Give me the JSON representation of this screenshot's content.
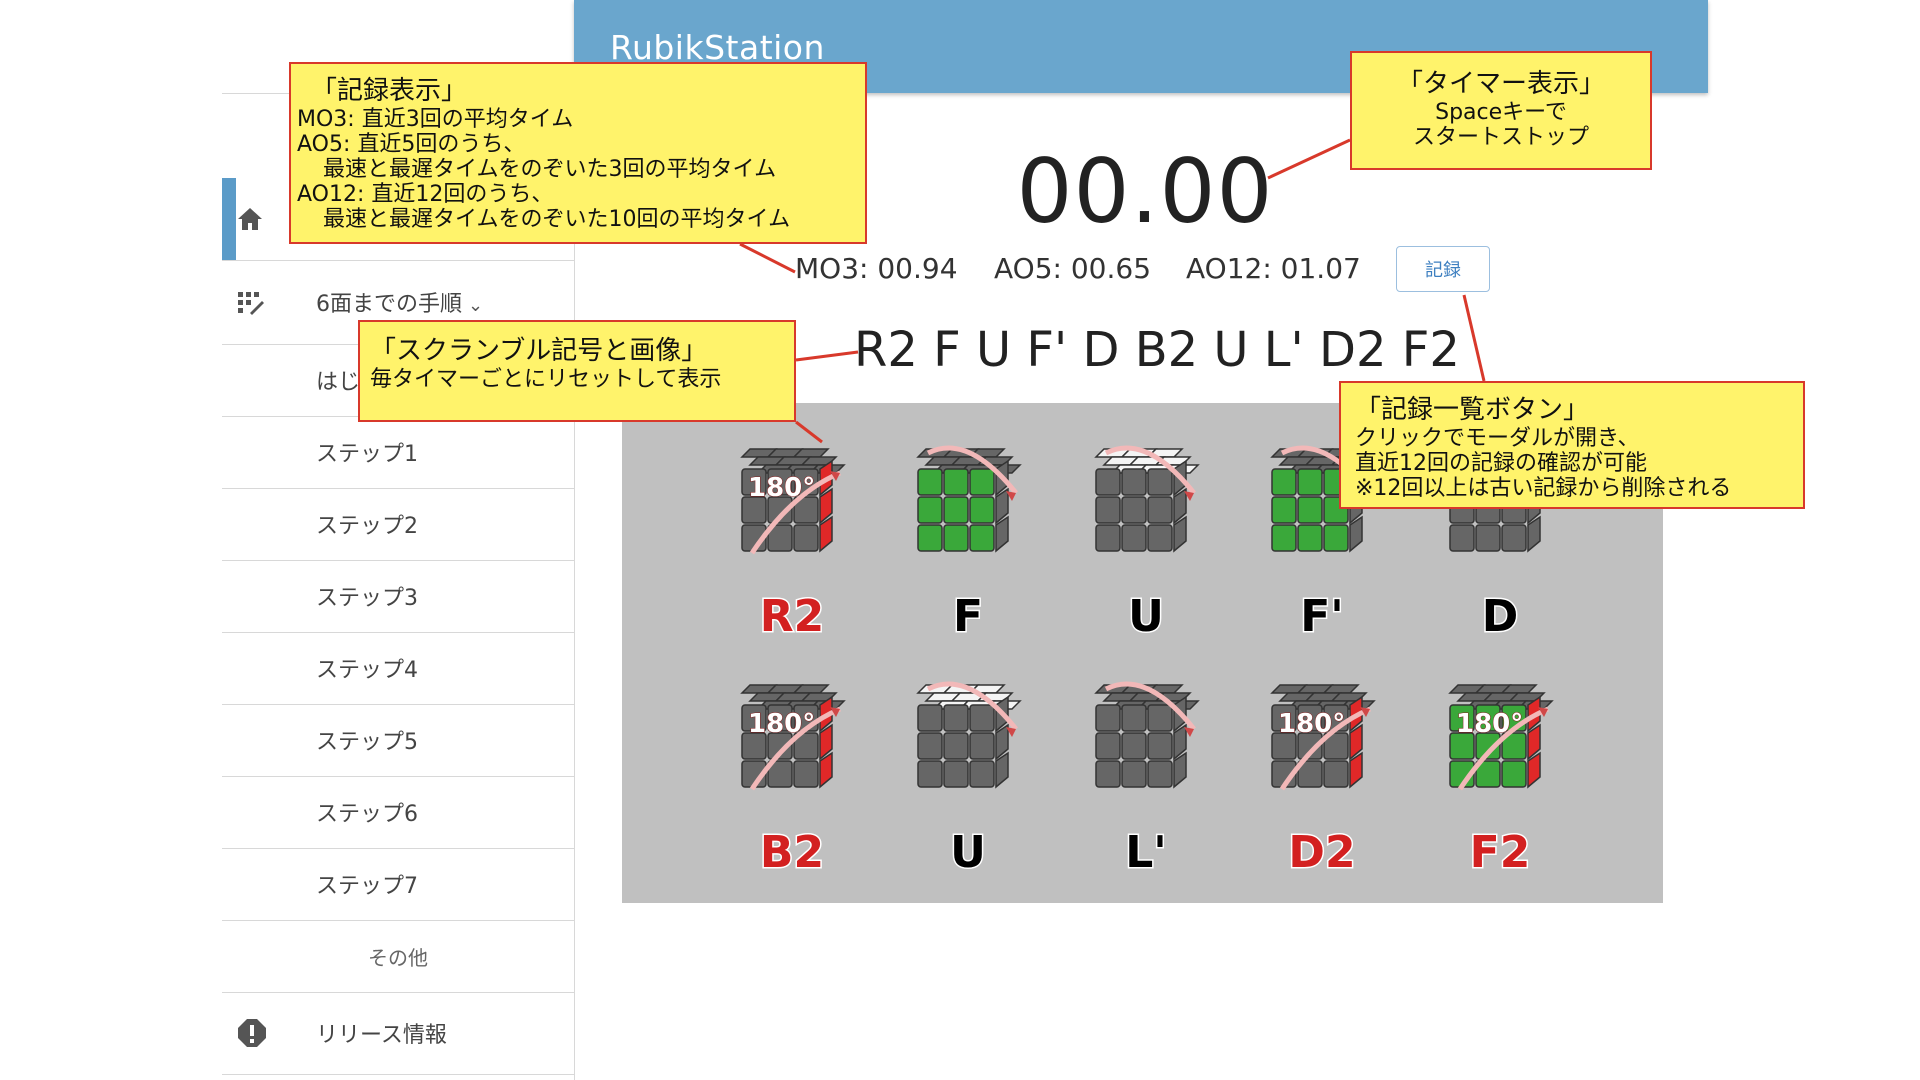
{
  "header": {
    "app_title": "RubikStation"
  },
  "sidebar": {
    "home_icon": "home-icon",
    "items": [
      {
        "id": "steps",
        "label": "6面までの手順",
        "icon": "steps-icon"
      },
      {
        "id": "start",
        "label": "はじ"
      },
      {
        "id": "step1",
        "label": "ステップ1"
      },
      {
        "id": "step2",
        "label": "ステップ2"
      },
      {
        "id": "step3",
        "label": "ステップ3"
      },
      {
        "id": "step4",
        "label": "ステップ4"
      },
      {
        "id": "step5",
        "label": "ステップ5"
      },
      {
        "id": "step6",
        "label": "ステップ6"
      },
      {
        "id": "step7",
        "label": "ステップ7"
      },
      {
        "id": "other",
        "label": "その他"
      },
      {
        "id": "release",
        "label": "リリース情報",
        "icon": "alert-icon"
      }
    ]
  },
  "timer": {
    "value": "00.00"
  },
  "stats": {
    "mo3": "MO3: 00.94",
    "ao5": "AO5: 00.65",
    "ao12": "AO12: 01.07"
  },
  "record_button": {
    "label": "記録"
  },
  "scramble": {
    "text": "R2 F U F' D B2 U L' D2 F2",
    "moves": [
      {
        "label": "R2",
        "double": true,
        "rotation": "180°"
      },
      {
        "label": "F",
        "double": false,
        "rotation": ""
      },
      {
        "label": "U",
        "double": false,
        "rotation": ""
      },
      {
        "label": "F'",
        "double": false,
        "rotation": ""
      },
      {
        "label": "D",
        "double": false,
        "rotation": ""
      },
      {
        "label": "B2",
        "double": true,
        "rotation": "180°"
      },
      {
        "label": "U",
        "double": false,
        "rotation": ""
      },
      {
        "label": "L'",
        "double": false,
        "rotation": ""
      },
      {
        "label": "D2",
        "double": true,
        "rotation": "180°"
      },
      {
        "label": "F2",
        "double": true,
        "rotation": "180°"
      }
    ]
  },
  "callouts": {
    "records": {
      "title": "「記録表示」",
      "lines": [
        "MO3: 直近3回の平均タイム",
        "AO5: 直近5回のうち、",
        "最速と最遅タイムをのぞいた3回の平均タイム",
        "AO12: 直近12回のうち、",
        "最速と最遅タイムをのぞいた10回の平均タイム"
      ]
    },
    "timer": {
      "title": "「タイマー表示」",
      "lines": [
        "Spaceキーで",
        "スタートストップ"
      ]
    },
    "scramble": {
      "title": "「スクランブル記号と画像」",
      "lines": [
        "毎タイマーごとにリセットして表示"
      ]
    },
    "list": {
      "title": "「記録一覧ボタン」",
      "lines": [
        "クリックでモーダルが開き、",
        "直近12回の記録の確認が可能",
        "※12回以上は古い記録から削除される"
      ]
    }
  },
  "colors": {
    "header_bg": "#6aa6cd",
    "accent": "#5b9bc8",
    "callout_bg": "#fff36b",
    "callout_border": "#d8392b",
    "cube_gray": "#666666",
    "cube_green": "#3aa83a",
    "cube_red": "#e02828",
    "cube_white": "#f4f4f4",
    "panel_bg": "#c0c0c0"
  }
}
